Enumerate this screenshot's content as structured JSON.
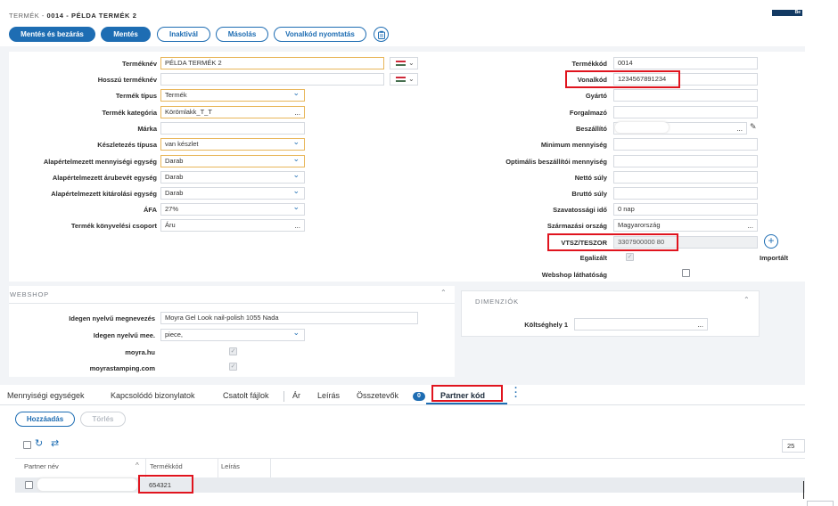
{
  "breadcrumb": {
    "section": "TERMÉK",
    "separator": " - ",
    "title": "0014 - PÉLDA TERMÉK 2"
  },
  "toolbar": {
    "save_close": "Mentés és bezárás",
    "save": "Mentés",
    "inactivate": "Inaktivál",
    "copy": "Másolás",
    "print_barcode": "Vonalkód nyomtatás",
    "clipboard_icon": "clipboard-icon"
  },
  "corner_badge": "Be",
  "left_form": {
    "name_label": "Terméknév",
    "name_value": "PÉLDA TERMÉK 2",
    "long_name_label": "Hosszú terméknév",
    "long_name_value": "",
    "type_label": "Termék típus",
    "type_value": "Termék",
    "category_label": "Termék kategória",
    "category_value": "Körömlakk_T_T",
    "brand_label": "Márka",
    "brand_value": "",
    "stock_type_label": "Készletezés típusa",
    "stock_type_value": "van készlet",
    "qty_unit_label": "Alapértelmezett mennyiségi egység",
    "qty_unit_value": "Darab",
    "purchase_unit_label": "Alapértelmezett árubevét egység",
    "purchase_unit_value": "Darab",
    "sales_unit_label": "Alapértelmezett kitárolási egység",
    "sales_unit_value": "Darab",
    "vat_label": "ÁFA",
    "vat_value": "27%",
    "accounting_label": "Termék könyvelési csoport",
    "accounting_value": "Áru"
  },
  "right_form": {
    "code_label": "Termékkód",
    "code_value": "0014",
    "barcode_label": "Vonalkód",
    "barcode_value": "1234567891234",
    "manufacturer_label": "Gyártó",
    "manufacturer_value": "",
    "distributor_label": "Forgalmazó",
    "distributor_value": "",
    "supplier_label": "Beszállító",
    "min_qty_label": "Minimum mennyiség",
    "min_qty_value": "",
    "opt_qty_label": "Optimális beszállítói mennyiség",
    "opt_qty_value": "",
    "net_weight_label": "Nettó súly",
    "net_weight_value": "",
    "gross_weight_label": "Bruttó súly",
    "gross_weight_value": "",
    "warranty_label": "Szavatossági idő",
    "warranty_value": "0 nap",
    "origin_label": "Származási ország",
    "origin_value": "Magyarország",
    "vtsz_label": "VTSZ/TESZOR",
    "vtsz_value": "3307900000 80",
    "import_label": "Importált",
    "aligned_label": "Egalizált",
    "webshop_visibility_label": "Webshop láthatóság"
  },
  "webshop": {
    "title": "WEBSHOP",
    "foreign_name_label": "Idegen nyelvű megnevezés",
    "foreign_name_value": "Moyra Gel Look nail-polish 1055 Nada",
    "foreign_unit_label": "Idegen nyelvű mee.",
    "foreign_unit_value": "piece,",
    "site1_label": "moyra.hu",
    "site2_label": "moyrastamping.com"
  },
  "dimensions": {
    "title": "DIMENZIÓK",
    "cost_center_label": "Költséghely 1",
    "cost_center_value": ""
  },
  "tabs": [
    {
      "label": "Mennyiségi egységek"
    },
    {
      "label": "Kapcsolódó bizonylatok"
    },
    {
      "label": "Csatolt fájlok"
    },
    {
      "label": "Ár"
    },
    {
      "label": "Leírás"
    },
    {
      "label": "Összetevők"
    },
    {
      "label": "Partner kód"
    }
  ],
  "tab_badge": "0",
  "grid": {
    "add_label": "Hozzáadás",
    "delete_label": "Törlés",
    "page_size": "25",
    "columns": [
      "Partner név",
      "Termékkód",
      "Leírás"
    ],
    "rows": [
      {
        "partner": "",
        "code": "654321",
        "desc": ""
      }
    ]
  },
  "colors": {
    "accent": "#1e6db3",
    "highlight": "#e0141e",
    "required_border": "#e8b65a"
  }
}
